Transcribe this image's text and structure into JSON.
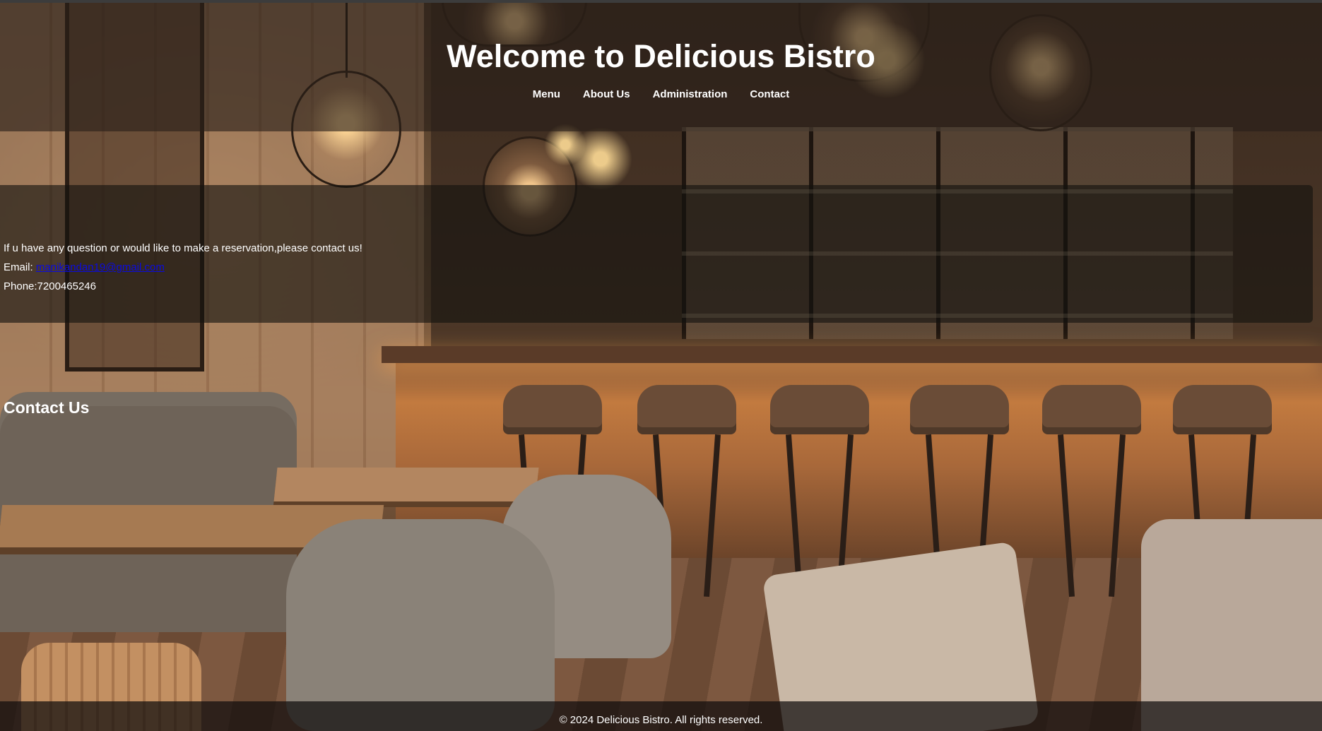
{
  "site": {
    "title": "Welcome to Delicious Bistro"
  },
  "nav": {
    "items": [
      {
        "label": "Menu"
      },
      {
        "label": "About Us"
      },
      {
        "label": "Administration"
      },
      {
        "label": "Contact"
      }
    ]
  },
  "contact": {
    "heading": "Contact Us",
    "intro": "If u have any question or would like to make a reservation,please contact us!",
    "email_label": "Email: ",
    "email_value": "manikandan19@gmail.com",
    "phone_text": "Phone:7200465246"
  },
  "footer": {
    "text": "© 2024 Delicious Bistro. All rights reserved."
  },
  "colors": {
    "header_overlay": "#281e18",
    "contact_overlay": "#14110f",
    "link": "#0a0ae0",
    "text": "#ffffff"
  }
}
